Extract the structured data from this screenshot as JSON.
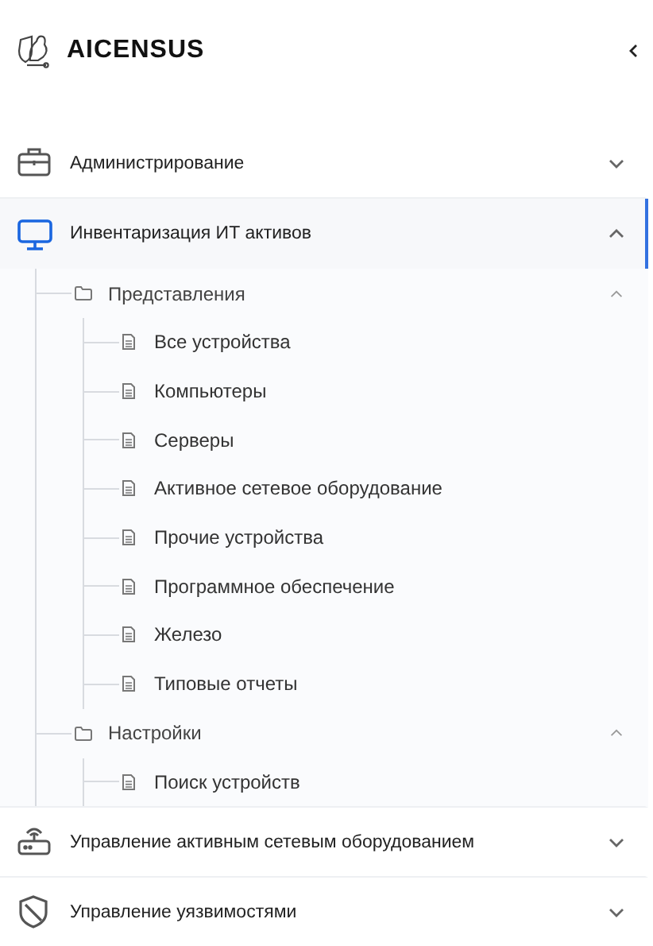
{
  "logo": {
    "text": "AICENSUS"
  },
  "menu": [
    {
      "label": "Администрирование",
      "expanded": false,
      "selected": false
    },
    {
      "label": "Инвентаризация ИТ активов",
      "expanded": true,
      "selected": true,
      "children": [
        {
          "label": "Представления",
          "expanded": true,
          "children": [
            {
              "label": "Все устройства"
            },
            {
              "label": "Компьютеры"
            },
            {
              "label": "Серверы"
            },
            {
              "label": "Активное сетевое оборудование"
            },
            {
              "label": "Прочие устройства"
            },
            {
              "label": "Программное обеспечение"
            },
            {
              "label": "Железо"
            },
            {
              "label": "Типовые отчеты"
            }
          ]
        },
        {
          "label": "Настройки",
          "expanded": true,
          "children": [
            {
              "label": "Поиск устройств"
            }
          ]
        }
      ]
    },
    {
      "label": "Управление активным сетевым оборудованием",
      "expanded": false,
      "selected": false
    },
    {
      "label": "Управление уязвимостями",
      "expanded": false,
      "selected": false
    }
  ]
}
